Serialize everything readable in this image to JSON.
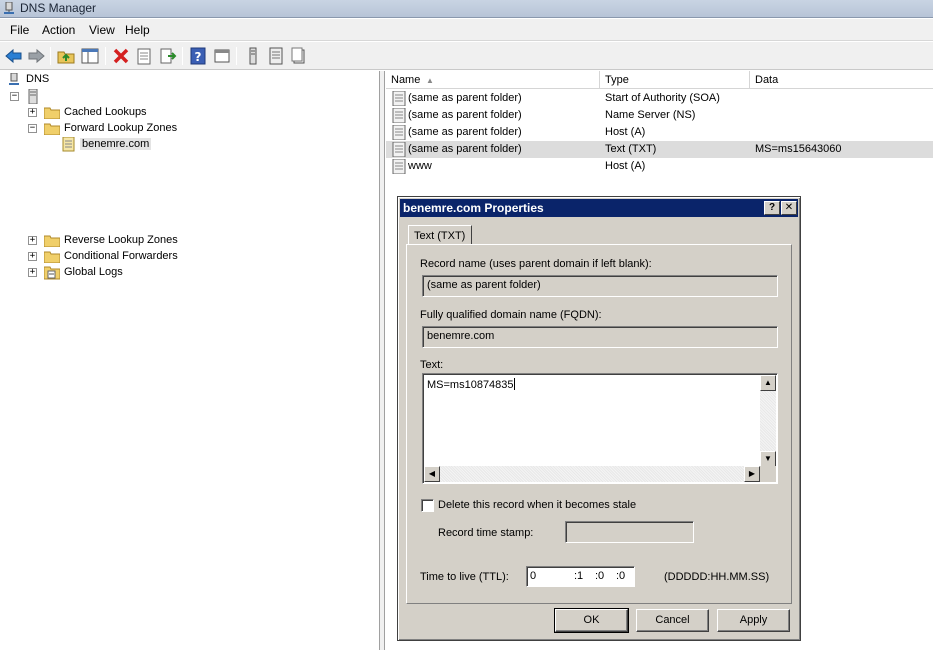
{
  "window": {
    "title": "DNS Manager"
  },
  "menu": [
    "File",
    "Action",
    "View",
    "Help"
  ],
  "toolbar_icons": [
    "back-arrow-icon",
    "forward-arrow-icon",
    "up-folder-icon",
    "show-hide-tree-icon",
    "delete-icon",
    "properties-icon",
    "export-list-icon",
    "help-icon",
    "console-icon",
    "server-icon",
    "list-icon",
    "zone-icon"
  ],
  "tree": {
    "root": "DNS",
    "cached": "Cached Lookups",
    "forward": "Forward Lookup Zones",
    "zone": "benemre.com",
    "reverse": "Reverse Lookup Zones",
    "conditional": "Conditional Forwarders",
    "logs": "Global Logs",
    "expand_plus": "+",
    "expand_minus": "−"
  },
  "list": {
    "columns": [
      "Name",
      "Type",
      "Data"
    ],
    "sort_indicator": "▲",
    "rows": [
      {
        "name": "(same as parent folder)",
        "type": "Start of Authority (SOA)",
        "data": ""
      },
      {
        "name": "(same as parent folder)",
        "type": "Name Server (NS)",
        "data": ""
      },
      {
        "name": "(same as parent folder)",
        "type": "Host (A)",
        "data": ""
      },
      {
        "name": "(same as parent folder)",
        "type": "Text (TXT)",
        "data": "MS=ms15643060"
      },
      {
        "name": "www",
        "type": "Host (A)",
        "data": ""
      }
    ]
  },
  "dialog": {
    "title": "benemre.com Properties",
    "help_btn": "?",
    "close_btn": "✕",
    "tab": "Text (TXT)",
    "record_name_label": "Record name (uses parent domain if left blank):",
    "record_name_value": "(same as parent folder)",
    "fqdn_label": "Fully qualified domain name (FQDN):",
    "fqdn_value": "benemre.com",
    "text_label": "Text:",
    "text_value": "MS=ms10874835",
    "delete_stale_label": "Delete this record when it becomes stale",
    "delete_stale_checked": false,
    "timestamp_label": "Record time stamp:",
    "timestamp_value": "",
    "ttl_label": "Time to live (TTL):",
    "ttl": {
      "days": "0",
      "hours": ":1",
      "minutes": ":0",
      "seconds": ":0"
    },
    "ttl_format": "(DDDDD:HH.MM.SS)",
    "scroll_up": "▲",
    "scroll_down": "▼",
    "scroll_left": "◀",
    "scroll_right": "▶",
    "buttons": {
      "ok": "OK",
      "cancel": "Cancel",
      "apply": "Apply"
    }
  },
  "colors": {
    "dialog_title_bg": "#0a246a",
    "dialog_face": "#d4d0c8",
    "selected_row": "#dcdcdc"
  }
}
